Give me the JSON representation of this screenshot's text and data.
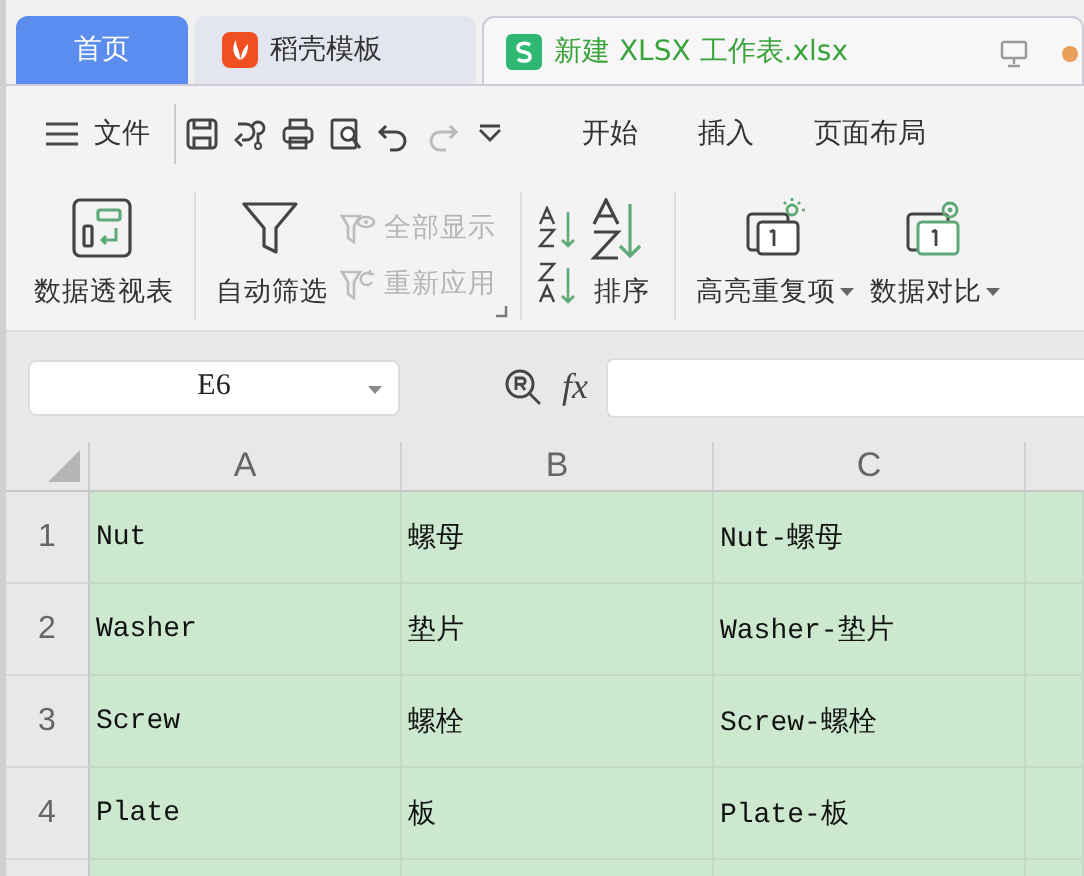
{
  "tabs": [
    {
      "kind": "home",
      "label": "首页",
      "selected": false
    },
    {
      "kind": "template",
      "label": "稻壳模板",
      "selected": false
    },
    {
      "kind": "sheet",
      "label": "新建 XLSX 工作表.xlsx",
      "selected": true
    }
  ],
  "menu": {
    "file": "文件",
    "items": [
      {
        "label": "开始"
      },
      {
        "label": "插入"
      },
      {
        "label": "页面布局"
      }
    ]
  },
  "ribbon": [
    {
      "kind": "large",
      "label": "数据透视表",
      "dropdown": false
    },
    {
      "kind": "large",
      "label": "自动筛选",
      "dropdown": false
    },
    {
      "kind": "pair",
      "items": [
        {
          "label": "全部显示",
          "disabled": true
        },
        {
          "label": "重新应用",
          "disabled": true
        }
      ]
    },
    {
      "kind": "sortpair"
    },
    {
      "kind": "sort",
      "label": "排序",
      "dropdown": false
    },
    {
      "kind": "large",
      "label": "高亮重复项",
      "dropdown": true
    },
    {
      "kind": "large",
      "label": "数据对比",
      "dropdown": true
    }
  ],
  "formula_bar": {
    "name_box": "E6",
    "fx": "fx"
  },
  "sheet": {
    "columns": [
      "A",
      "B",
      "C"
    ],
    "rows": [
      {
        "number": "1",
        "selected": true,
        "cells": [
          "Nut",
          "螺母",
          "Nut-螺母"
        ]
      },
      {
        "number": "2",
        "selected": true,
        "cells": [
          "Washer",
          "垫片",
          "Washer-垫片"
        ]
      },
      {
        "number": "3",
        "selected": true,
        "cells": [
          "Screw",
          "螺栓",
          "Screw-螺栓"
        ]
      },
      {
        "number": "4",
        "selected": true,
        "cells": [
          "Plate",
          "板",
          "Plate-板"
        ]
      }
    ]
  }
}
